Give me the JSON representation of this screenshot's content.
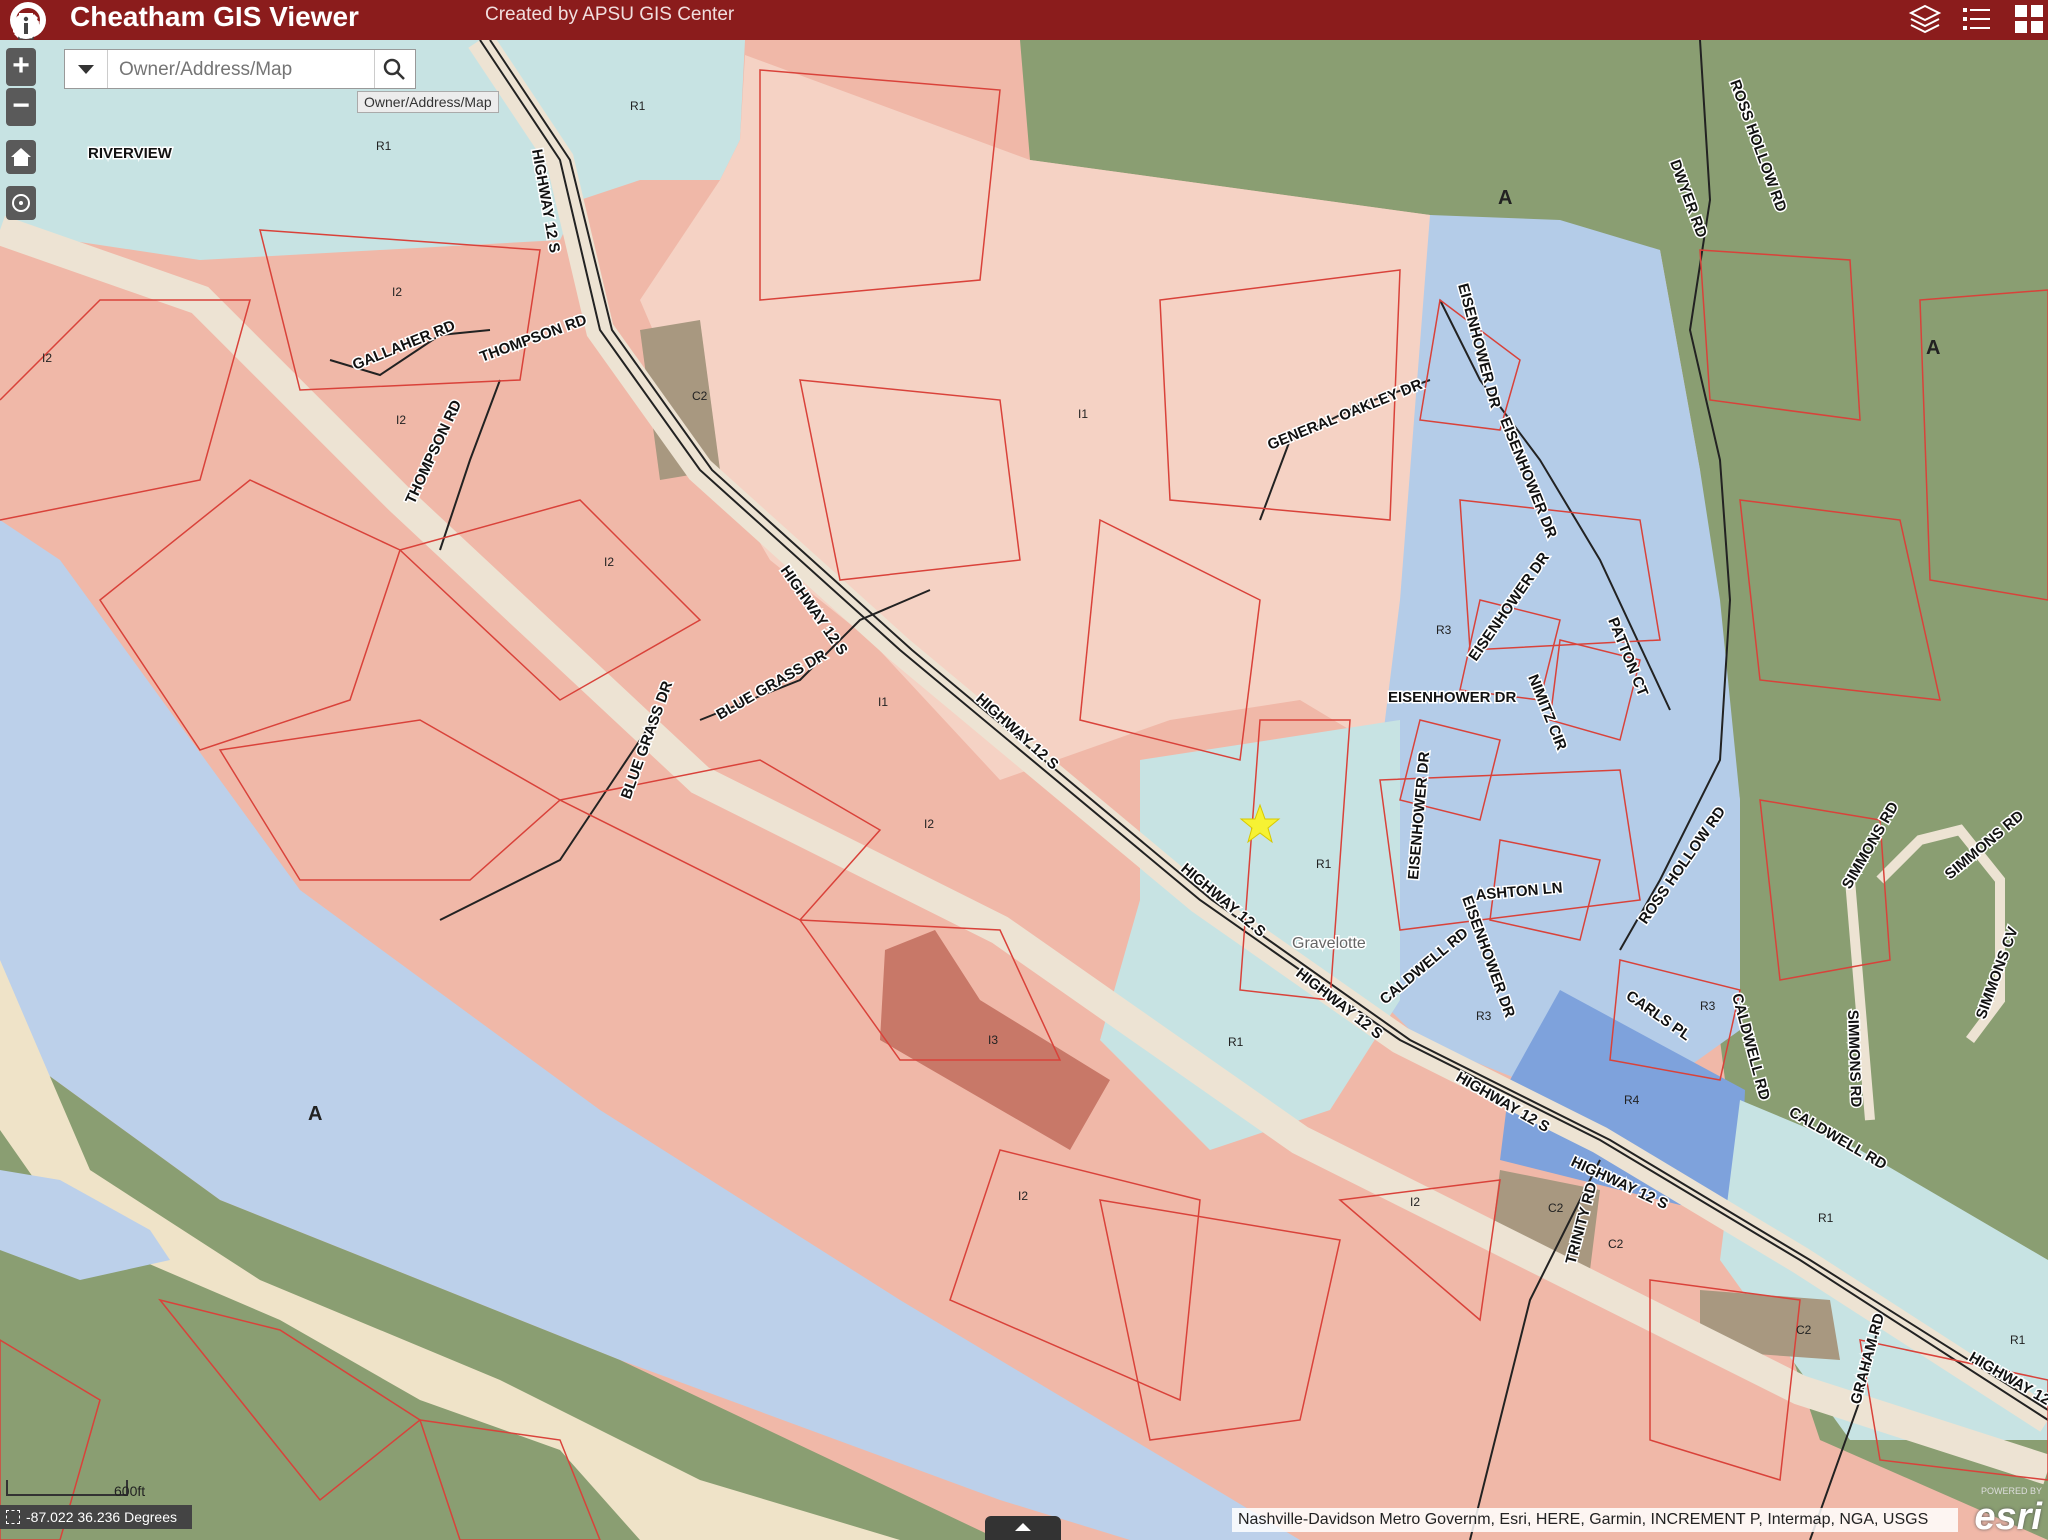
{
  "app": {
    "title": "Cheatham GIS Viewer",
    "subtitle": "Created by APSU GIS Center"
  },
  "header": {
    "logo_icon": "seal-icon",
    "layers_icon": "layers-icon",
    "legend_icon": "list-icon",
    "basemap_icon": "grid-icon"
  },
  "controls": {
    "zoom_in": "+",
    "zoom_out": "−",
    "home_icon": "home-icon",
    "locate_icon": "locate-icon"
  },
  "search": {
    "placeholder": "Owner/Address/Map",
    "tooltip": "Owner/Address/Map"
  },
  "tools": [
    "graduation-cap-icon",
    "ruler-icon",
    "draw-icon",
    "print-icon",
    "info-icon"
  ],
  "scale": {
    "label": "600ft"
  },
  "coordinates": {
    "text": "-87.022 36.236 Degrees"
  },
  "attribution": "Nashville-Davidson Metro Governm, Esri, HERE, Garmin, INCREMENT P, Intermap, NGA, USGS",
  "esri": {
    "powered": "POWERED BY",
    "logo": "esri"
  },
  "colors": {
    "header": "#8b1c1c",
    "industrial": "#f0b8a8",
    "light_industrial": "#f5d2c4",
    "heavy_industrial": "#c87868",
    "residential": "#c7e3e3",
    "r3": "#b4cce8",
    "r4": "#7ea2dc",
    "agricultural": "#8a9e72",
    "river": "#bcd0ea",
    "parcel_line": "#d9423a"
  },
  "map": {
    "roads": [
      {
        "name": "HIGHWAY 12 S"
      },
      {
        "name": "HIGHWAY 12 S"
      },
      {
        "name": "HIGHWAY 12 S"
      },
      {
        "name": "HIGHWAY 12 S"
      },
      {
        "name": "HIGHWAY 12 S"
      },
      {
        "name": "HIGHWAY 12 S"
      },
      {
        "name": "HIGHWAY 12 S"
      },
      {
        "name": "HIGHWAY 12 S"
      },
      {
        "name": "THOMPSON RD"
      },
      {
        "name": "THOMPSON RD"
      },
      {
        "name": "GALLAHER RD"
      },
      {
        "name": "BLUE GRASS DR"
      },
      {
        "name": "BLUE GRASS DR"
      },
      {
        "name": "GENERAL OAKLEY DR"
      },
      {
        "name": "EISENHOWER DR"
      },
      {
        "name": "EISENHOWER DR"
      },
      {
        "name": "EISENHOWER DR"
      },
      {
        "name": "EISENHOWER DR"
      },
      {
        "name": "EISENHOWER DR"
      },
      {
        "name": "EISENHOWER DR"
      },
      {
        "name": "NIMITZ CIR"
      },
      {
        "name": "PATTON CT"
      },
      {
        "name": "ASHTON LN"
      },
      {
        "name": "CALDWELL RD"
      },
      {
        "name": "CALDWELL RD"
      },
      {
        "name": "CALDWELL RD"
      },
      {
        "name": "CARLS PL"
      },
      {
        "name": "ROSS HOLLOW RD"
      },
      {
        "name": "ROSS HOLLOW RD"
      },
      {
        "name": "DWYER RD"
      },
      {
        "name": "SIMMONS RD"
      },
      {
        "name": "SIMMONS RD"
      },
      {
        "name": "SIMMONS RD"
      },
      {
        "name": "SIMMONS CV"
      },
      {
        "name": "TRINITY RD"
      },
      {
        "name": "GRAHAM RD"
      },
      {
        "name": "RIVERVIEW"
      }
    ],
    "zones": [
      "A",
      "A",
      "A",
      "I2",
      "I2",
      "I2",
      "I2",
      "I1",
      "I1",
      "I2",
      "I3",
      "I2",
      "I2",
      "R1",
      "R1",
      "R1",
      "R1",
      "R1",
      "R1",
      "R3",
      "R3",
      "R3",
      "R4",
      "C2",
      "C2",
      "C2",
      "C2"
    ],
    "places": [
      "Gravelotte"
    ],
    "marker": "star-icon"
  }
}
